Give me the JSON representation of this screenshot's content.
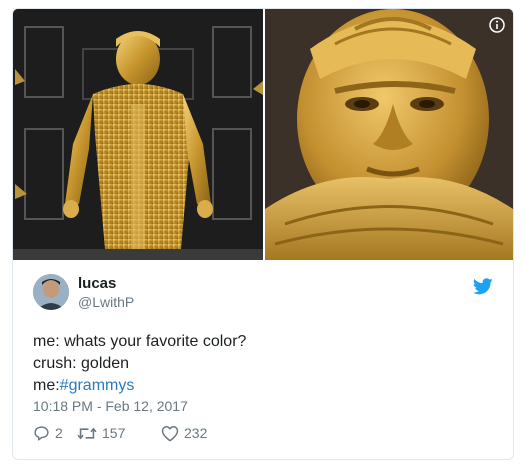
{
  "tweet": {
    "author_name": "lucas",
    "author_handle": "@LwithP",
    "text_lines": [
      "me: whats your favorite color?",
      "crush: golden",
      "me:"
    ],
    "hashtag": "#grammys",
    "timestamp": "10:18 PM - Feb 12, 2017",
    "replies": "2",
    "retweets": "157",
    "likes": "232"
  },
  "media": {
    "left_alt": "gold costume full body photo",
    "right_alt": "gold costume face close-up photo"
  },
  "colors": {
    "link": "#2b7bb9",
    "muted": "#697882",
    "twitter_blue": "#1da1f2",
    "border": "#e1e8ed"
  },
  "icons": [
    "info-icon",
    "twitter-bird-icon",
    "reply-icon",
    "retweet-icon",
    "like-icon"
  ]
}
